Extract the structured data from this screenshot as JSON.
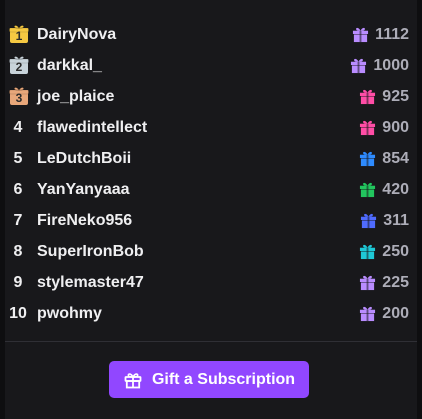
{
  "leaderboard": {
    "entries": [
      {
        "rank": "1",
        "medal": "gold",
        "user": "DairyNova",
        "amount": "1112",
        "gift_color": "#b98cff"
      },
      {
        "rank": "2",
        "medal": "silver",
        "user": "darkkal_",
        "amount": "1000",
        "gift_color": "#b98cff"
      },
      {
        "rank": "3",
        "medal": "bronze",
        "user": "joe_plaice",
        "amount": "925",
        "gift_color": "#ff4da6"
      },
      {
        "rank": "4",
        "medal": "",
        "user": "flawedintellect",
        "amount": "900",
        "gift_color": "#ff4da6"
      },
      {
        "rank": "5",
        "medal": "",
        "user": "LeDutchBoii",
        "amount": "854",
        "gift_color": "#2e8bff"
      },
      {
        "rank": "6",
        "medal": "",
        "user": "YanYanyaaa",
        "amount": "420",
        "gift_color": "#22c55e"
      },
      {
        "rank": "7",
        "medal": "",
        "user": "FireNeko956",
        "amount": "311",
        "gift_color": "#4f6bff"
      },
      {
        "rank": "8",
        "medal": "",
        "user": "SuperIronBob",
        "amount": "250",
        "gift_color": "#1ec8d6"
      },
      {
        "rank": "9",
        "medal": "",
        "user": "stylemaster47",
        "amount": "225",
        "gift_color": "#b98cff"
      },
      {
        "rank": "10",
        "medal": "",
        "user": "pwohmy",
        "amount": "200",
        "gift_color": "#b98cff"
      }
    ]
  },
  "medal_colors": {
    "gold": "#f5c842",
    "silver": "#c8d3da",
    "bronze": "#e8a77a"
  },
  "icons": {
    "gift": "gift-icon",
    "medal": "medal-icon"
  },
  "footer": {
    "gift_button_label": "Gift a Subscription",
    "button_color": "#9147ff"
  }
}
